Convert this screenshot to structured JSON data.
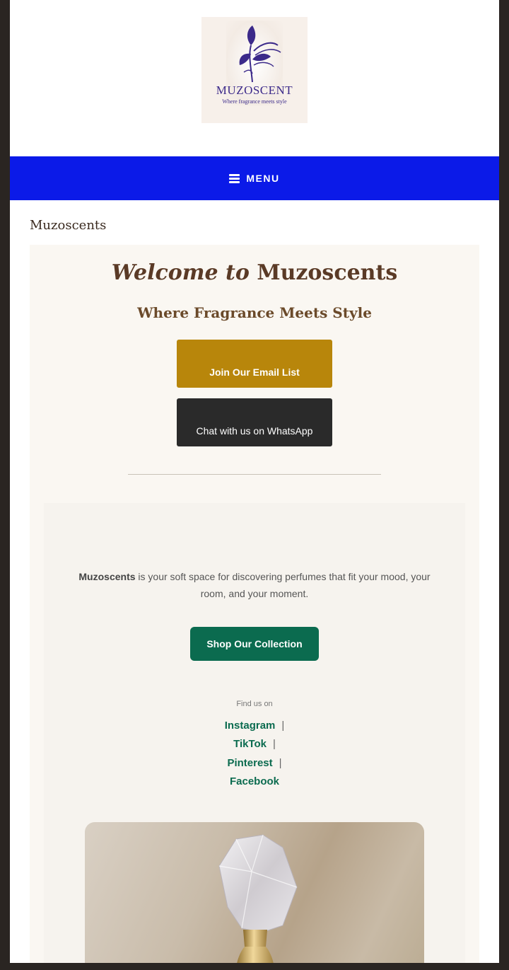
{
  "brand": {
    "logo_word": "MUZOSCENT",
    "logo_tagline": "Where fragrance meets style"
  },
  "nav": {
    "menu_label": "MENU"
  },
  "site_title": "Muzoscents",
  "hero": {
    "welcome_prefix": "Welcome to",
    "welcome_name": "Muzoscents",
    "tagline": "Where Fragrance Meets Style",
    "email_button": "Join Our Email List",
    "whatsapp_button": "Chat with us on WhatsApp"
  },
  "about": {
    "brand_bold": "Muzoscents",
    "description": " is your soft space for discovering perfumes that fit your mood, your room, and your moment.",
    "shop_button": "Shop Our Collection"
  },
  "social": {
    "find_label": "Find us on",
    "links": [
      "Instagram",
      "TikTok",
      "Pinterest",
      "Facebook"
    ],
    "separator": "|"
  },
  "colors": {
    "nav_bg": "#0b1ae8",
    "gold": "#b8860b",
    "green": "#0b6b4f",
    "brown_text": "#5a3a26"
  }
}
